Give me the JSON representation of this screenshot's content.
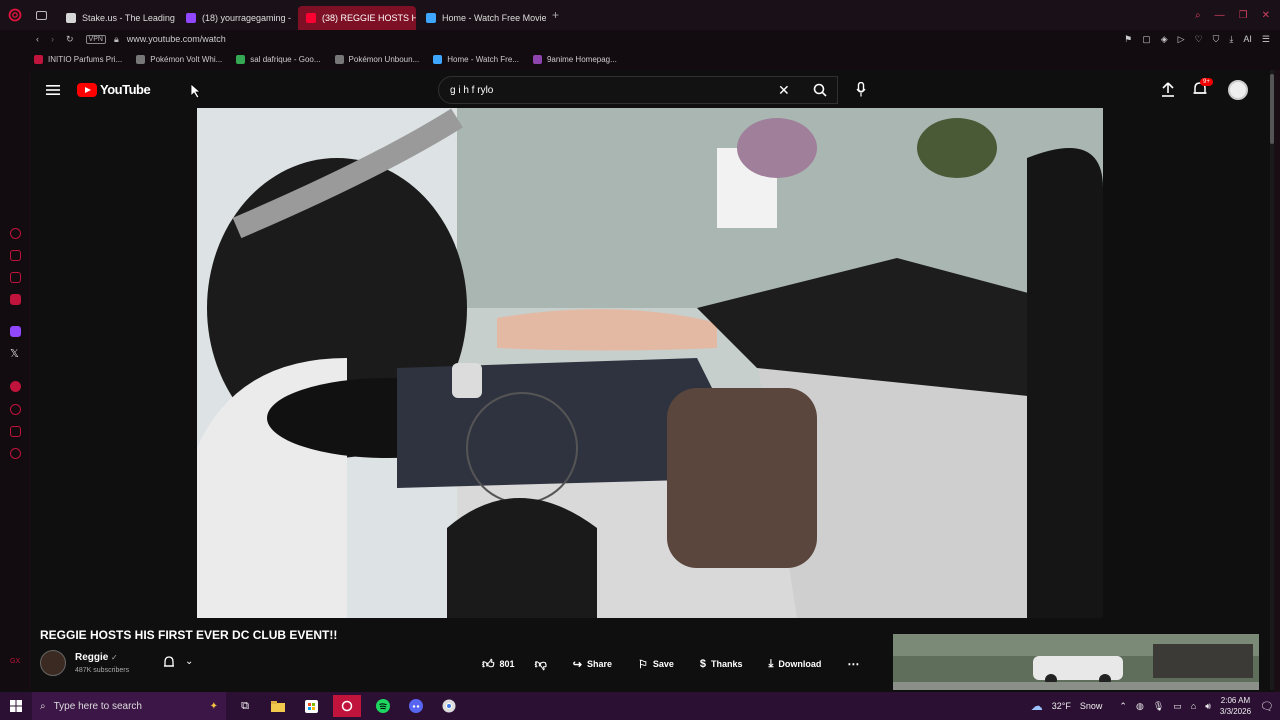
{
  "browser": {
    "tabs": [
      {
        "label": "Stake.us - The Leading Sc",
        "color": "#d6d6d6"
      },
      {
        "label": "(18) yourragegaming -",
        "color": "#9146ff"
      },
      {
        "label": "(38) REGGIE HOSTS H",
        "color": "#ff0033",
        "active": true
      },
      {
        "label": "Home - Watch Free Movie",
        "color": "#3ea6ff"
      }
    ],
    "url": "www.youtube.com/watch",
    "vpn_label": "VPN",
    "ai_label": "AI",
    "bookmarks": [
      {
        "label": "INITIO Parfums Pri...",
        "color": "#c0143c"
      },
      {
        "label": "Pokémon Volt Whi...",
        "color": "#777"
      },
      {
        "label": "sal dafrique - Goo...",
        "color": "#34a853"
      },
      {
        "label": "Pokémon Unboun...",
        "color": "#777"
      },
      {
        "label": "Home - Watch Fre...",
        "color": "#3ea6ff"
      },
      {
        "label": "9anime Homepag...",
        "color": "#8e44ad"
      }
    ]
  },
  "youtube": {
    "logo_text": "YouTube",
    "search_value": "g i h f rylo",
    "notification_badge": "9+",
    "video": {
      "title": "REGGIE HOSTS HIS FIRST EVER DC CLUB EVENT!!",
      "channel": "Reggie",
      "subscribers": "487K subscribers",
      "likes": "801",
      "share_label": "Share",
      "save_label": "Save",
      "thanks_label": "Thanks",
      "download_label": "Download"
    }
  },
  "taskbar": {
    "search_placeholder": "Type here to search",
    "weather_temp": "32°F",
    "weather_label": "Snow",
    "time": "2:06 AM",
    "date": "3/3/2026"
  }
}
